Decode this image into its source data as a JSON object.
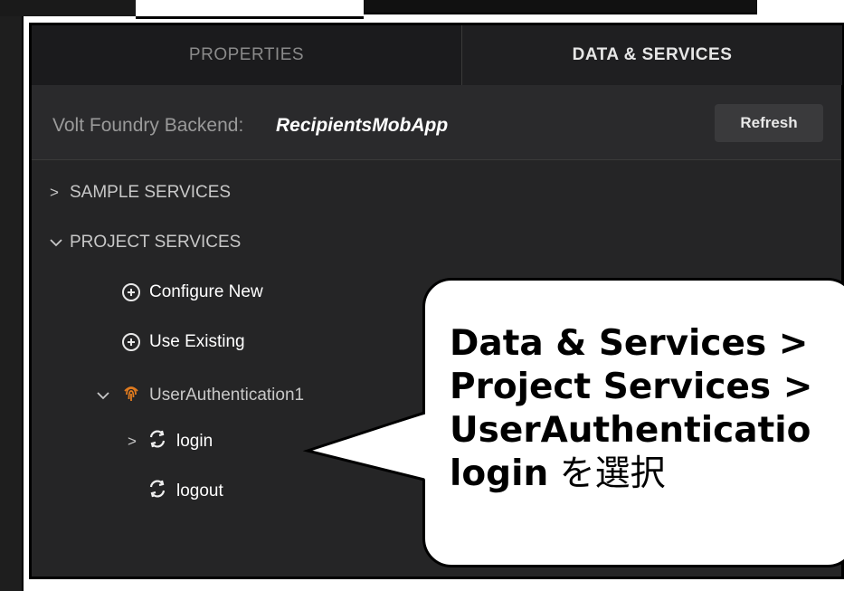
{
  "tabs": [
    {
      "label": "PROPERTIES",
      "active": false
    },
    {
      "label": "DATA & SERVICES",
      "active": true
    }
  ],
  "backend": {
    "label": "Volt Foundry Backend:",
    "name": "RecipientsMobApp",
    "refresh_label": "Refresh"
  },
  "tree": {
    "sample_services": "SAMPLE SERVICES",
    "project_services": "PROJECT SERVICES",
    "configure_new": "Configure New",
    "use_existing": "Use Existing",
    "user_auth": "UserAuthentication1",
    "login": "login",
    "logout": "logout"
  },
  "callout": {
    "line1": "Data & Services >",
    "line2": "Project Services >",
    "line3": "UserAuthenticatio",
    "line4_bold": "login",
    "line4_rest": " を選択"
  },
  "colors": {
    "panel_bg": "#252526",
    "tab_bg": "#1c1c1e",
    "accent_orange": "#e07b1f"
  }
}
